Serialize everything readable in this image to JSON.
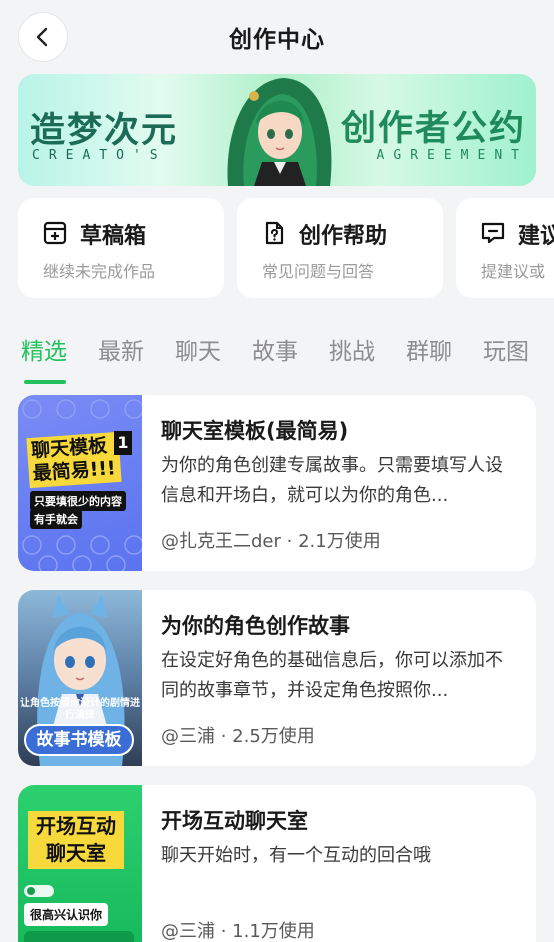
{
  "header": {
    "title": "创作中心",
    "back_icon": "chevron-left-icon"
  },
  "banner": {
    "left_title": "造梦次元",
    "left_sub": "CREATO'S",
    "right_title": "创作者公约",
    "right_sub": "AGREEMENT"
  },
  "quick_cards": [
    {
      "icon": "draft-box-icon",
      "title": "草稿箱",
      "subtitle": "继续未完成作品"
    },
    {
      "icon": "document-help-icon",
      "title": "创作帮助",
      "subtitle": "常见问题与回答"
    },
    {
      "icon": "feedback-message-icon",
      "title": "建议",
      "subtitle": "提建议或"
    }
  ],
  "tabs": [
    {
      "label": "精选",
      "active": true
    },
    {
      "label": "最新",
      "active": false
    },
    {
      "label": "聊天",
      "active": false
    },
    {
      "label": "故事",
      "active": false
    },
    {
      "label": "挑战",
      "active": false
    },
    {
      "label": "群聊",
      "active": false
    },
    {
      "label": "玩图",
      "active": false
    }
  ],
  "templates": [
    {
      "title": "聊天室模板(最简易)",
      "description": "为你的角色创建专属故事。只需要填写人设信息和开场白，就可以为你的角色...",
      "meta": "@扎克王二der · 2.1万使用",
      "thumb": {
        "label": "聊天模板 最简易!!!",
        "number": "1",
        "tag1": "只要填很少的内容",
        "tag2": "有手就会"
      }
    },
    {
      "title": "为你的角色创作故事",
      "description": "在设定好角色的基础信息后，你可以添加不同的故事章节，并设定角色按照你...",
      "meta": "@三浦 · 2.5万使用",
      "thumb": {
        "caption": "让角色按照你设计的剧情进行演绎",
        "pill": "故事书模板"
      }
    },
    {
      "title": "开场互动聊天室",
      "description": "聊天开始时，有一个互动的回合哦",
      "meta": "@三浦 · 1.1万使用",
      "thumb": {
        "label": "开场互动 聊天室",
        "bubble": "很高兴认识你"
      }
    }
  ],
  "colors": {
    "accent": "#23c15c",
    "background": "#f3f4f6",
    "card": "#ffffff",
    "muted_text": "#9a9a9a"
  }
}
